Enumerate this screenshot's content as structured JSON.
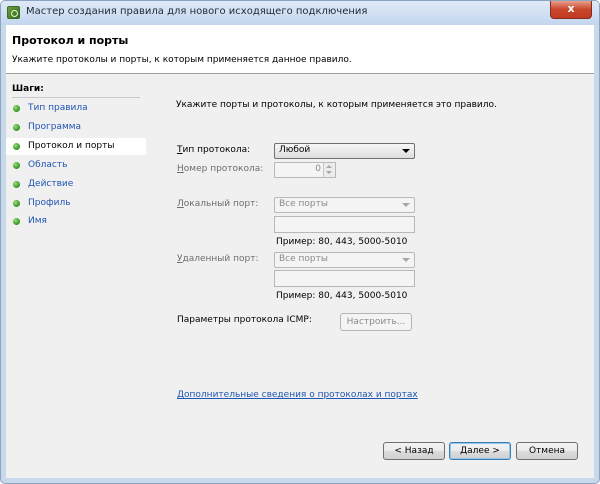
{
  "window": {
    "title": "Мастер создания правила для нового исходящего подключения",
    "close_label": "x"
  },
  "header": {
    "title": "Протокол и порты",
    "subtitle": "Укажите протоколы и порты, к которым применяется данное правило."
  },
  "sidebar": {
    "label": "Шаги:",
    "items": [
      {
        "label": "Тип правила"
      },
      {
        "label": "Программа"
      },
      {
        "label": "Протокол и порты"
      },
      {
        "label": "Область"
      },
      {
        "label": "Действие"
      },
      {
        "label": "Профиль"
      },
      {
        "label": "Имя"
      }
    ],
    "current_index": 2
  },
  "main": {
    "intro": "Укажите порты и протоколы, к которым применяется это правило.",
    "protocol_type": {
      "label_accel": "Т",
      "label_rest": "ип протокола:",
      "value": "Любой"
    },
    "protocol_number": {
      "label_accel": "Н",
      "label_rest": "омер протокола:",
      "value": "0"
    },
    "local_port": {
      "label_accel": "Л",
      "label_rest": "окальный порт:",
      "value": "Все порты",
      "example": "Пример: 80, 443, 5000-5010"
    },
    "remote_port": {
      "label_accel": "У",
      "label_rest": "даленный порт:",
      "value": "Все порты",
      "example": "Пример: 80, 443, 5000-5010"
    },
    "icmp": {
      "label": "Параметры протокола ICMP:",
      "button": "Настроить..."
    },
    "link": "Дополнительные сведения о протоколах и портах"
  },
  "footer": {
    "back": "< Назад",
    "next": "Далее >",
    "cancel": "Отмена"
  }
}
